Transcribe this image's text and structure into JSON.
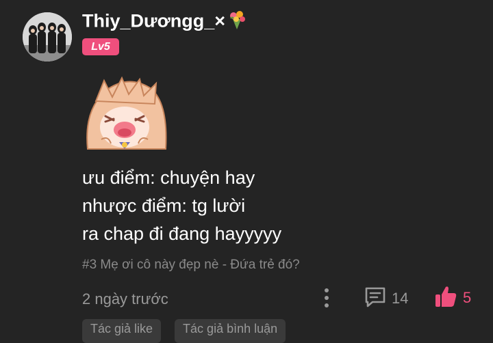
{
  "user": {
    "name": "Thiy_Dươngg_×",
    "level": "Lv5",
    "avatar_icon": "group-photo-avatar",
    "decoration_icon": "flower-bouquet-icon"
  },
  "comment": {
    "sticker_icon": "anime-girl-crying-sticker",
    "lines": [
      "ưu điểm: chuyện hay",
      "nhược điểm: tg lười",
      "ra chap đi đang hayyyyy"
    ]
  },
  "chapter_ref": "#3 Mẹ ơi cô này đẹp nè - Đứa trẻ đó?",
  "footer": {
    "time": "2 ngày trước",
    "reply_count": "14",
    "like_count": "5"
  },
  "chips": [
    "Tác giả like",
    "Tác giả bình luận"
  ],
  "colors": {
    "background": "#242424",
    "accent": "#ef4f7d",
    "muted": "#9a9a9a"
  }
}
